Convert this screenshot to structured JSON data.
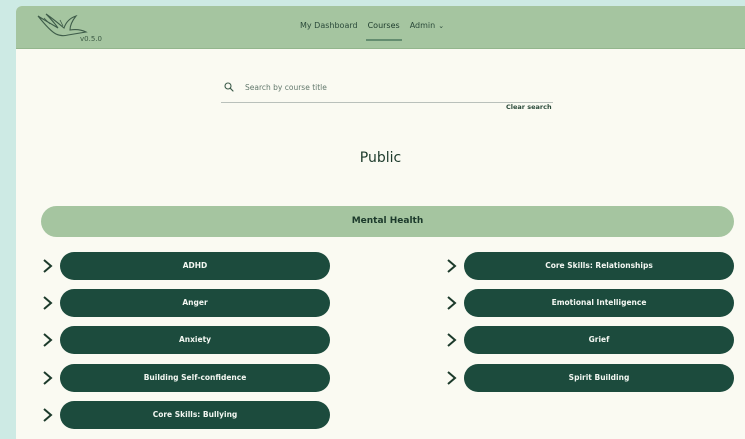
{
  "nav": {
    "logo_icon": "bird-logo-icon",
    "version": "v0.5.0",
    "links": {
      "dashboard": "My Dashboard",
      "courses": "Courses",
      "admin": "Admin"
    },
    "admin_chevron": "⌄"
  },
  "search": {
    "icon": "search-icon",
    "placeholder": "Search by course title",
    "value": "",
    "clear_label": "Clear search"
  },
  "page": {
    "title": "Public"
  },
  "category": {
    "name": "Mental Health"
  },
  "courses": {
    "left": [
      {
        "title": "ADHD"
      },
      {
        "title": "Anger"
      },
      {
        "title": "Anxiety"
      },
      {
        "title": "Building Self-confidence"
      },
      {
        "title": "Core Skills: Bullying"
      }
    ],
    "right": [
      {
        "title": "Core Skills: Relationships"
      },
      {
        "title": "Emotional Intelligence"
      },
      {
        "title": "Grief"
      },
      {
        "title": "Spirit Building"
      }
    ]
  },
  "colors": {
    "accent_green": "#a5c5a0",
    "dark_green": "#1c4b3d",
    "page_bg": "#fafaf2",
    "outer_bg": "#cdeae4"
  }
}
